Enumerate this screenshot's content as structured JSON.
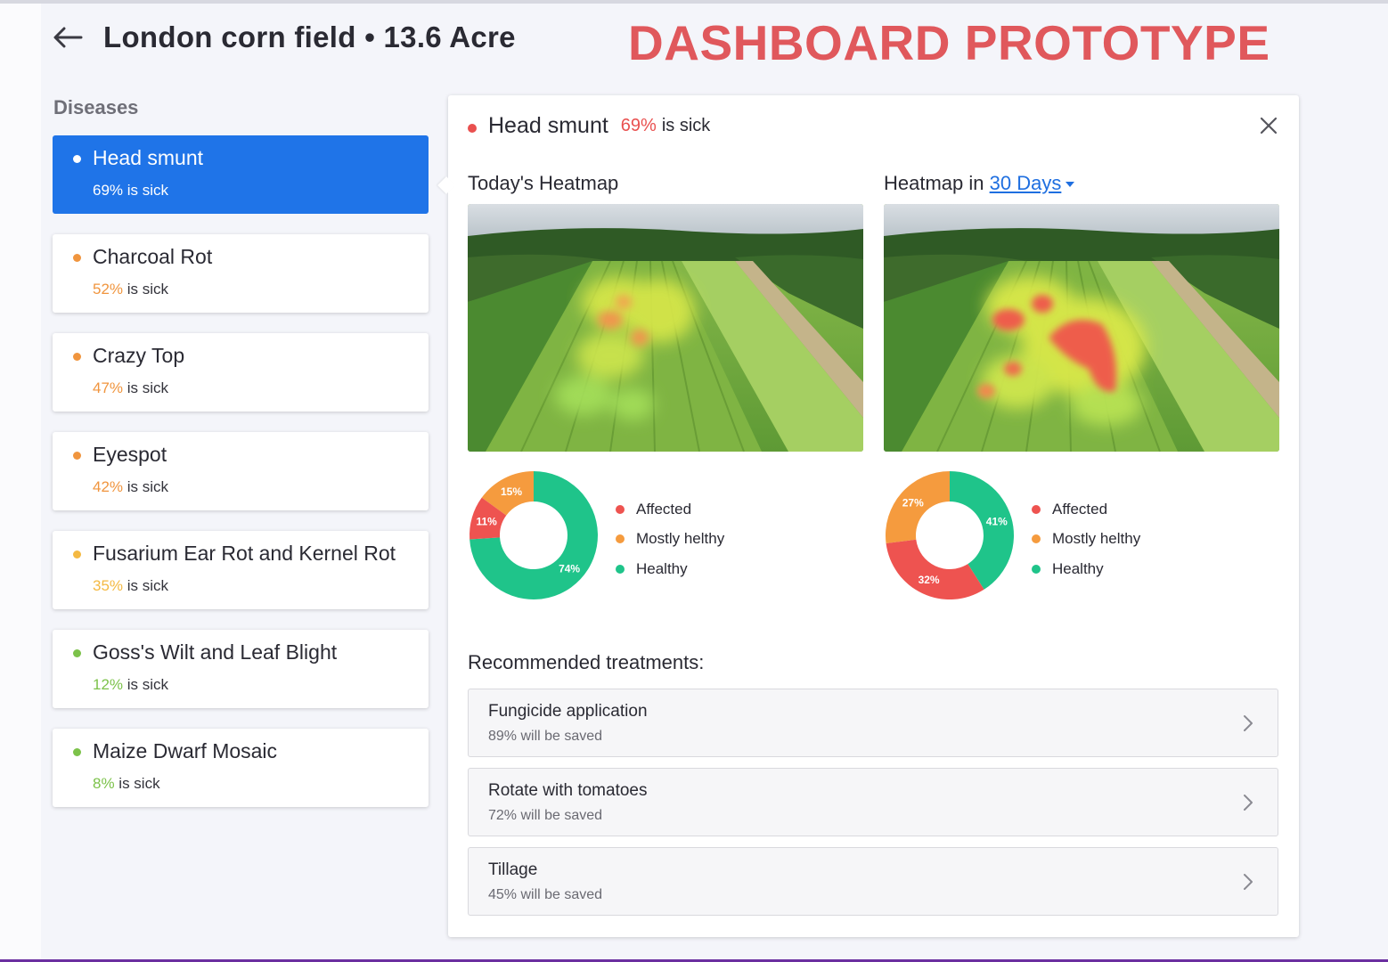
{
  "header": {
    "title": "London corn field • 13.6 Acre",
    "banner": "DASHBOARD PROTOTYPE"
  },
  "sidebar": {
    "title": "Diseases",
    "items": [
      {
        "name": "Head smunt",
        "pct": "69%",
        "suffix": " is sick",
        "color": "#ffffff",
        "active": true
      },
      {
        "name": "Charcoal Rot",
        "pct": "52%",
        "suffix": " is sick",
        "color": "#f0953e",
        "active": false
      },
      {
        "name": "Crazy Top",
        "pct": "47%",
        "suffix": " is sick",
        "color": "#f0953e",
        "active": false
      },
      {
        "name": "Eyespot",
        "pct": "42%",
        "suffix": " is sick",
        "color": "#f0953e",
        "active": false
      },
      {
        "name": "Fusarium Ear Rot and Kernel Rot",
        "pct": "35%",
        "suffix": " is sick",
        "color": "#f4b942",
        "active": false
      },
      {
        "name": "Goss's Wilt and Leaf Blight",
        "pct": "12%",
        "suffix": " is sick",
        "color": "#7cc24a",
        "active": false
      },
      {
        "name": "Maize Dwarf Mosaic",
        "pct": "8%",
        "suffix": " is sick",
        "color": "#7cc24a",
        "active": false
      }
    ]
  },
  "panel": {
    "disease_name": "Head smunt",
    "pct": "69%",
    "suffix": "is sick",
    "today_title": "Today's Heatmap",
    "future_prefix": "Heatmap in",
    "future_link": "30 Days",
    "treatments_title": "Recommended treatments:",
    "treatments": [
      {
        "name": "Fungicide application",
        "sub": "89% will be saved"
      },
      {
        "name": "Rotate with tomatoes",
        "sub": "72% will be saved"
      },
      {
        "name": "Tillage",
        "sub": "45% will be saved"
      }
    ]
  },
  "legend": {
    "affected": "Affected",
    "mostly": "Mostly helthy",
    "healthy": "Healthy"
  },
  "colors": {
    "affected": "#ee5350",
    "mostly": "#f59b3e",
    "healthy": "#1fc48a",
    "accent": "#1f74e8"
  },
  "chart_data": [
    {
      "type": "pie",
      "title": "Today's Heatmap",
      "categories": [
        "Affected",
        "Mostly helthy",
        "Healthy"
      ],
      "values": [
        11,
        15,
        74
      ],
      "labels": [
        "11%",
        "15%",
        "74%"
      ]
    },
    {
      "type": "pie",
      "title": "Heatmap in 30 Days",
      "categories": [
        "Affected",
        "Mostly helthy",
        "Healthy"
      ],
      "values": [
        32,
        27,
        41
      ],
      "labels": [
        "32%",
        "27%",
        "41%"
      ]
    }
  ]
}
